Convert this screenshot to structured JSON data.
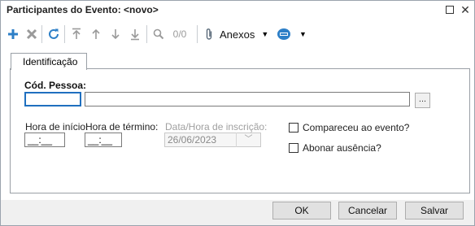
{
  "window": {
    "title": "Participantes do Evento: <novo>"
  },
  "toolbar": {
    "counter": "0/0",
    "anexos_label": "Anexos",
    "accent_color": "#1f6fbf"
  },
  "tabs": [
    {
      "label": "Identificação"
    }
  ],
  "form": {
    "cod_pessoa_label": "Cód. Pessoa:",
    "cod_pessoa_value": "",
    "nome_value": "",
    "lookup_label": "...",
    "hora_inicio_label": "Hora de início:",
    "hora_inicio_value": "__:__",
    "hora_termino_label": "Hora de término:",
    "hora_termino_value": "__:__",
    "data_inscricao_label": "Data/Hora de inscrição:",
    "data_inscricao_value": "26/06/2023",
    "compareceu_label": "Compareceu ao evento?",
    "compareceu_checked": false,
    "abonar_label": "Abonar ausência?",
    "abonar_checked": false
  },
  "buttons": {
    "ok": "OK",
    "cancel": "Cancelar",
    "save": "Salvar"
  }
}
